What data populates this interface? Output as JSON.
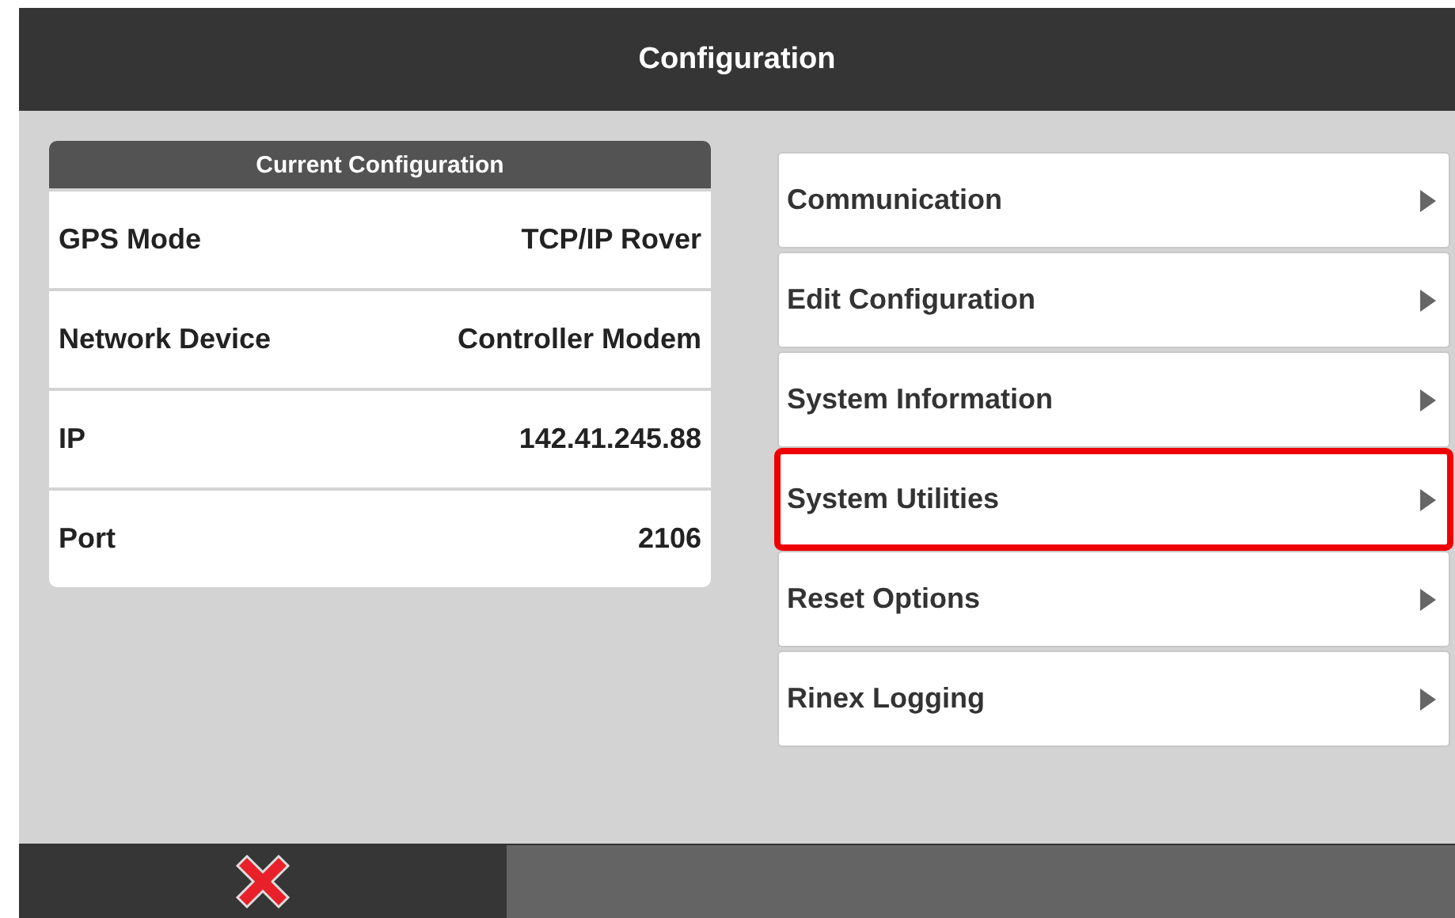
{
  "window": {
    "title": "Configuration"
  },
  "current_configuration": {
    "title": "Current Configuration",
    "rows": [
      {
        "label": "GPS Mode",
        "value": "TCP/IP Rover"
      },
      {
        "label": "Network Device",
        "value": "Controller Modem"
      },
      {
        "label": "IP",
        "value": "142.41.245.88"
      },
      {
        "label": "Port",
        "value": "2106"
      }
    ]
  },
  "menu": [
    {
      "label": "Communication",
      "highlighted": false
    },
    {
      "label": "Edit Configuration",
      "highlighted": false
    },
    {
      "label": "System Information",
      "highlighted": false
    },
    {
      "label": "System Utilities",
      "highlighted": true
    },
    {
      "label": "Reset Options",
      "highlighted": false
    },
    {
      "label": "Rinex Logging",
      "highlighted": false
    }
  ]
}
